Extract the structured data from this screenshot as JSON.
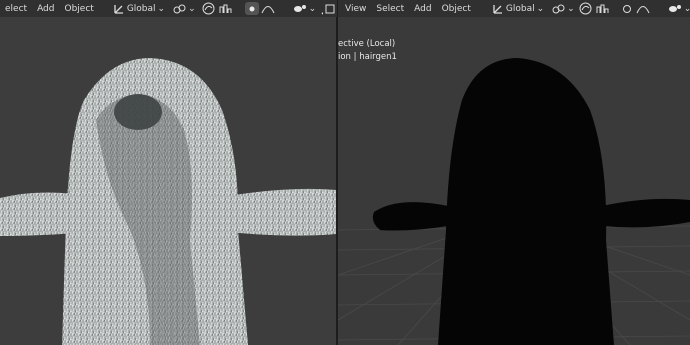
{
  "left_pane": {
    "menu": [
      "elect",
      "Add",
      "Object"
    ],
    "transform_orientation": "Global"
  },
  "right_pane": {
    "menu": [
      "View",
      "Select",
      "Add",
      "Object"
    ],
    "transform_orientation": "Global",
    "overlay": {
      "view_name": "ective (Local)",
      "object_info": "ion | hairgen1"
    }
  },
  "icons": {
    "orientation": "transform-orientation-icon",
    "pivot": "pivot-point-icon",
    "snap": "snap-icon",
    "snap_increment": "snap-increment-icon",
    "proportional": "proportional-editing-icon",
    "falloff": "falloff-curve-icon",
    "visibility": "object-visibility-icon",
    "gizmo": "gizmo-icon",
    "overlay": "overlay-icon",
    "shading": "shading-icon"
  },
  "colors": {
    "viewport_left": "#3d3d3d",
    "viewport_right": "#3a3a3a",
    "fur_light": "#c9cccb",
    "fur_dark": "#6f7272",
    "silhouette": "#050505"
  }
}
